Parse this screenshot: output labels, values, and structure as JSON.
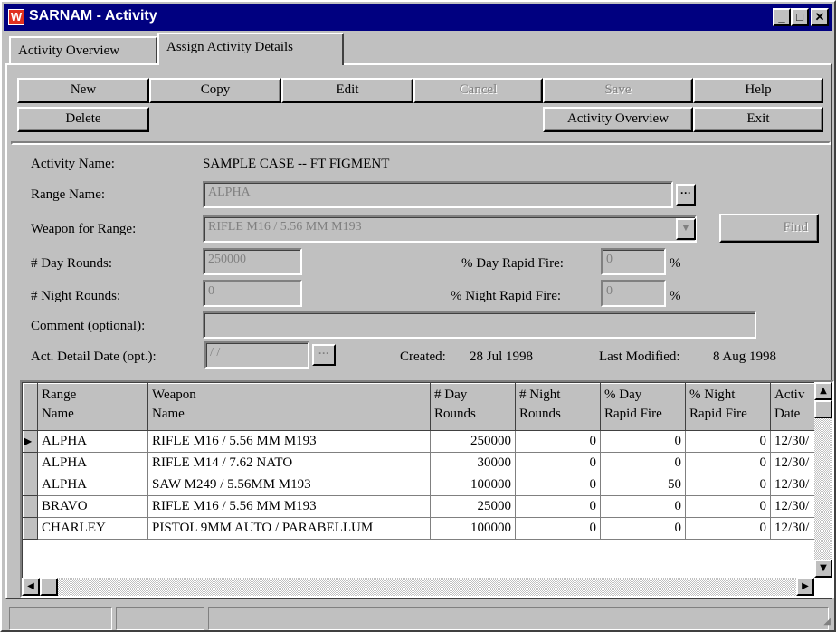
{
  "window": {
    "title": "SARNAM - Activity"
  },
  "tabs": [
    {
      "label": "Activity Overview"
    },
    {
      "label": "Assign Activity Details"
    }
  ],
  "toolbar": {
    "new": "New",
    "copy": "Copy",
    "edit": "Edit",
    "cancel": "Cancel",
    "save": "Save",
    "help": "Help",
    "delete": "Delete",
    "activity_overview": "Activity Overview",
    "exit": "Exit"
  },
  "form": {
    "activity_name_label": "Activity Name:",
    "activity_name_value": "SAMPLE CASE -- FT FIGMENT",
    "range_name_label": "Range Name:",
    "range_name_value": "ALPHA",
    "weapon_label": "Weapon for Range:",
    "weapon_value": "RIFLE M16 / 5.56 MM M193",
    "find_label": "Find",
    "day_rounds_label": "# Day Rounds:",
    "day_rounds_value": "250000",
    "night_rounds_label": "# Night Rounds:",
    "night_rounds_value": "0",
    "day_rapid_label": "% Day Rapid Fire:",
    "day_rapid_value": "0",
    "night_rapid_label": "% Night Rapid Fire:",
    "night_rapid_value": "0",
    "percent_sign": "%",
    "comment_label": "Comment (optional):",
    "comment_value": "",
    "detail_date_label": "Act. Detail Date (opt.):",
    "detail_date_value": " / /",
    "created_label": "Created:",
    "created_value": "28 Jul 1998",
    "modified_label": "Last Modified:",
    "modified_value": "8 Aug 1998"
  },
  "grid": {
    "headers": [
      [
        "Range",
        "Name"
      ],
      [
        "Weapon",
        "Name"
      ],
      [
        "# Day",
        "Rounds"
      ],
      [
        "# Night",
        "Rounds"
      ],
      [
        "% Day",
        "Rapid Fire"
      ],
      [
        "% Night",
        "Rapid Fire"
      ],
      [
        "Activ",
        "Date"
      ]
    ],
    "rows": [
      [
        "ALPHA",
        "RIFLE M16 / 5.56 MM M193",
        "250000",
        "0",
        "0",
        "0",
        "12/30/"
      ],
      [
        "ALPHA",
        "RIFLE M14 / 7.62 NATO",
        "30000",
        "0",
        "0",
        "0",
        "12/30/"
      ],
      [
        "ALPHA",
        "SAW M249 / 5.56MM M193",
        "100000",
        "0",
        "50",
        "0",
        "12/30/"
      ],
      [
        "BRAVO",
        "RIFLE M16 / 5.56 MM M193",
        "25000",
        "0",
        "0",
        "0",
        "12/30/"
      ],
      [
        "CHARLEY",
        "PISTOL 9MM AUTO / PARABELLUM",
        "100000",
        "0",
        "0",
        "0",
        "12/30/"
      ]
    ]
  }
}
